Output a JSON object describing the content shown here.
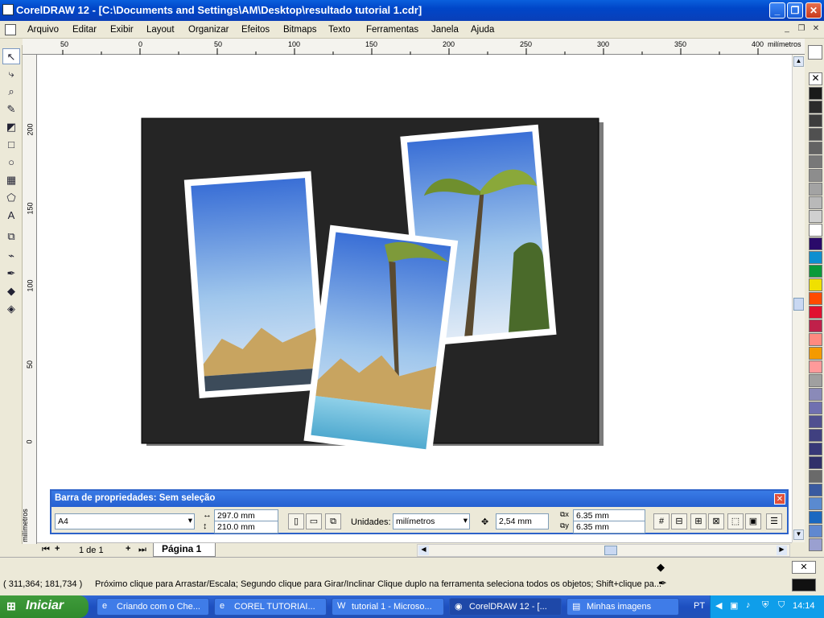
{
  "window": {
    "title": "CorelDRAW 12 - [C:\\Documents and Settings\\AM\\Desktop\\resultado tutorial 1.cdr]"
  },
  "menu": [
    "Arquivo",
    "Editar",
    "Exibir",
    "Layout",
    "Organizar",
    "Efeitos",
    "Bitmaps",
    "Texto",
    "Ferramentas",
    "Janela",
    "Ajuda"
  ],
  "ruler": {
    "unit": "milímetros",
    "h_labels": [
      "50",
      "0",
      "50",
      "100",
      "150",
      "200",
      "250",
      "300",
      "350",
      "400"
    ],
    "v_labels": [
      "200",
      "150",
      "100",
      "50",
      "0"
    ],
    "v_unit": "milímetros"
  },
  "property_bar": {
    "title": "Barra de propriedades: Sem seleção",
    "paper": "A4",
    "width": "297.0 mm",
    "height": "210.0 mm",
    "units_label": "Unidades:",
    "units_value": "milímetros",
    "nudge": "2,54 mm",
    "dup_x": "6.35 mm",
    "dup_y": "6.35 mm"
  },
  "page_nav": {
    "count": "1 de 1",
    "tab": "Página 1"
  },
  "status": {
    "coords": "( 311,364; 181,734 )",
    "message": "Próximo clique para Arrastar/Escala; Segundo clique para Girar/Inclinar Clique duplo na ferramenta seleciona todos os objetos; Shift+clique pa..."
  },
  "taskbar": {
    "start": "Iniciar",
    "tasks": [
      "Criando com o Che...",
      "COREL TUTORIAI...",
      "tutorial 1 - Microso...",
      "CorelDRAW 12 - [...",
      "Minhas imagens"
    ],
    "lang": "PT",
    "clock": "14:14"
  },
  "palette": [
    "#1a1a1a",
    "#2b2b2b",
    "#3d3d3d",
    "#505050",
    "#636363",
    "#787878",
    "#8d8d8d",
    "#a3a3a3",
    "#b9b9b9",
    "#d0d0d0",
    "#ffffff",
    "#2a0a6a",
    "#0d8fd0",
    "#0a9a3a",
    "#f0e000",
    "#ff4a00",
    "#e01030",
    "#c0204a",
    "#ff8a80",
    "#f49a00",
    "#ff9a9a",
    "#a0a0a0",
    "#8a8ab8",
    "#7070b0",
    "#505090",
    "#404080",
    "#383878",
    "#30306a",
    "#6a6a6a",
    "#3a5aa0",
    "#5a8ad0",
    "#1a68c0",
    "#6088d0",
    "#9aa0d0"
  ]
}
